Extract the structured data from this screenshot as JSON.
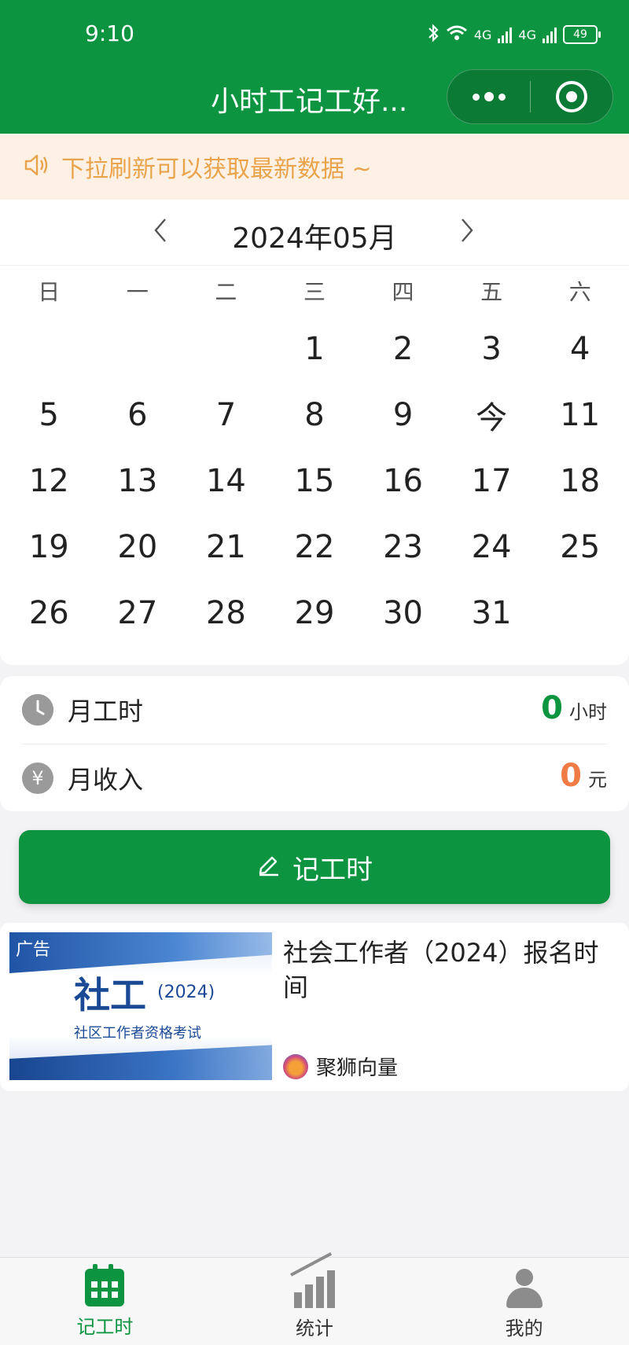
{
  "status_bar": {
    "time": "9:10",
    "net1": "4G",
    "net2": "4G",
    "battery": "49"
  },
  "nav": {
    "title": "小时工记工好..."
  },
  "notice": {
    "text": "下拉刷新可以获取最新数据 ~"
  },
  "calendar": {
    "month_title": "2024年05月",
    "weekdays": [
      "日",
      "一",
      "二",
      "三",
      "四",
      "五",
      "六"
    ],
    "days": [
      "",
      "",
      "",
      "1",
      "2",
      "3",
      "4",
      "5",
      "6",
      "7",
      "8",
      "9",
      "今",
      "11",
      "12",
      "13",
      "14",
      "15",
      "16",
      "17",
      "18",
      "19",
      "20",
      "21",
      "22",
      "23",
      "24",
      "25",
      "26",
      "27",
      "28",
      "29",
      "30",
      "31",
      ""
    ]
  },
  "stats": {
    "hours": {
      "label": "月工时",
      "value": "0",
      "unit": "小时",
      "color": "#0d9441"
    },
    "income": {
      "label": "月收入",
      "value": "0",
      "unit": "元",
      "color": "#f07b45",
      "icon_text": "¥"
    }
  },
  "record_button": {
    "label": "记工时"
  },
  "ad": {
    "tag": "广告",
    "image_big": "社工",
    "image_year": "(2024)",
    "image_sub": "社区工作者资格考试",
    "title": "社会工作者（2024）报名时间",
    "source": "聚狮向量"
  },
  "tabbar": {
    "tabs": [
      {
        "label": "记工时",
        "icon": "calendar-icon",
        "active": true
      },
      {
        "label": "统计",
        "icon": "chart-icon",
        "active": false
      },
      {
        "label": "我的",
        "icon": "user-icon",
        "active": false
      }
    ],
    "accent": "#0d9441"
  }
}
